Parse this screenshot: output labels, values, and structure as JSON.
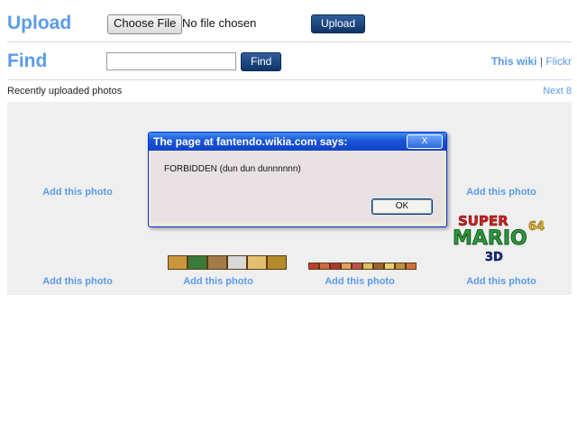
{
  "upload": {
    "label": "Upload",
    "choose_file": "Choose File",
    "file_status": "No file chosen",
    "button": "Upload"
  },
  "find": {
    "label": "Find",
    "input_value": "",
    "button": "Find",
    "link_wiki": "This wiki",
    "separator": "|",
    "link_flickr": "Flickr"
  },
  "recent": {
    "heading": "Recently uploaded photos",
    "next": "Next 8"
  },
  "gallery": {
    "add_label": "Add this photo"
  },
  "dialog": {
    "title": "The page at fantendo.wikia.com says:",
    "close": "X",
    "message": "FORBIDDEN (dun dun dunnnnnn)",
    "ok": "OK"
  },
  "logo": {
    "line1": "SUPER",
    "line2": "MARIO",
    "num": "64",
    "sub": "3D"
  },
  "colors": {
    "link": "#5b9bea",
    "button": "#0e3468",
    "gallery_bg": "#efefef",
    "dialog_title": "#1b54d8"
  }
}
